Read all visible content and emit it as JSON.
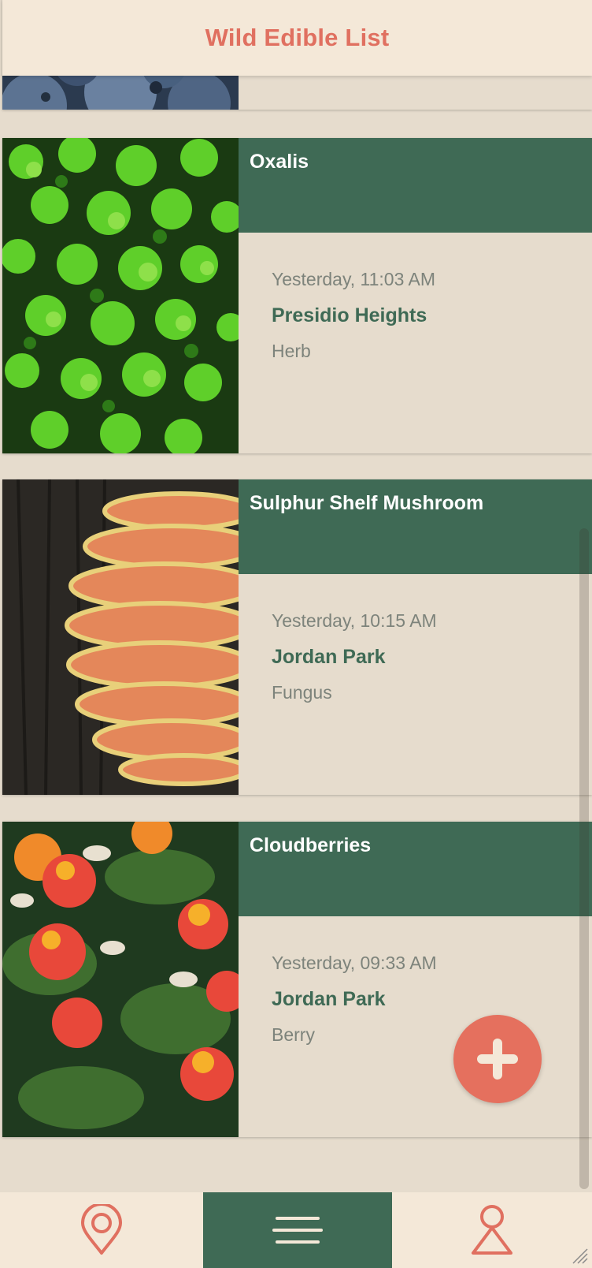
{
  "header": {
    "title": "Wild Edible List"
  },
  "items": [
    {
      "name": "",
      "time": "",
      "place": "",
      "type": "",
      "photo": "blueberries"
    },
    {
      "name": "Oxalis",
      "time": "Yesterday, 11:03 AM",
      "place": "Presidio Heights",
      "type": "Herb",
      "photo": "clover"
    },
    {
      "name": "Sulphur Shelf Mushroom",
      "time": "Yesterday, 10:15 AM",
      "place": "Jordan Park",
      "type": "Fungus",
      "photo": "mushroom"
    },
    {
      "name": "Cloudberries",
      "time": "Yesterday, 09:33 AM",
      "place": "Jordan Park",
      "type": "Berry",
      "photo": "cloudberries"
    }
  ],
  "fab": {
    "icon": "plus-icon",
    "color": "#e5705e"
  },
  "tabs": [
    {
      "id": "map",
      "icon": "map-pin-icon",
      "active": false
    },
    {
      "id": "list",
      "icon": "list-icon",
      "active": true
    },
    {
      "id": "profile",
      "icon": "profile-icon",
      "active": false
    }
  ],
  "colors": {
    "accent": "#e07060",
    "green": "#3f6a55",
    "cream": "#f4e8d8",
    "card": "#e6dccd",
    "muted": "#7d837b"
  }
}
